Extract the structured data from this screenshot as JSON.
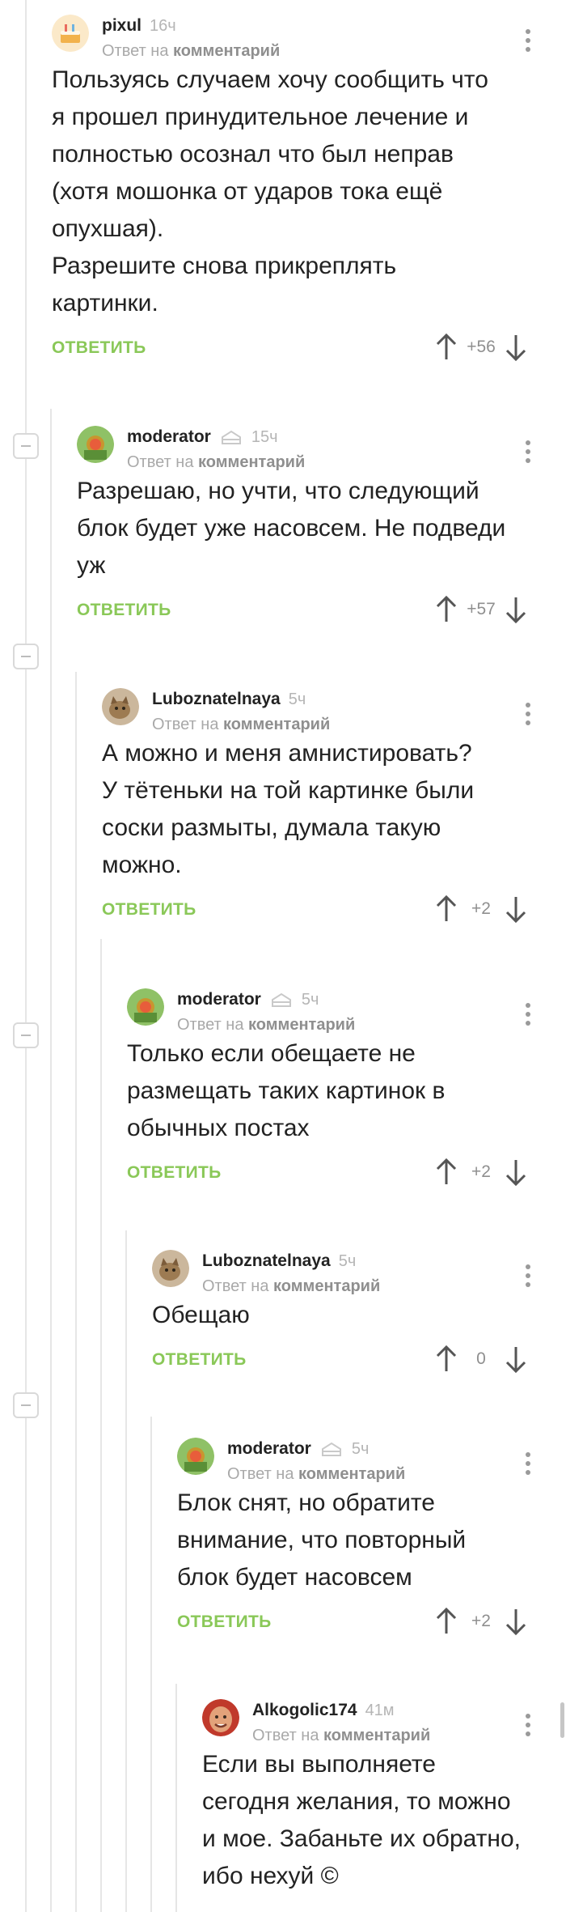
{
  "reply_label": "Ответ на",
  "reply_target": "комментарий",
  "action_reply": "ОТВЕТИТЬ",
  "colors": {
    "accent_green": "#8ac858",
    "thread_line": "#e6e6e6",
    "muted": "#a9a9a9"
  },
  "comments": [
    {
      "author": "pixul",
      "time": "16ч",
      "avatar": "cake-avatar",
      "text_lines": [
        "Пользуясь случаем хочу сообщить что",
        "я прошел принудительное лечение и",
        "полностью осознал что был неправ",
        "(хотя мошонка от ударов тока ещё",
        "опухшая).",
        "Разрешите снова прикреплять",
        "картинки."
      ],
      "rating": "+56"
    },
    {
      "author": "moderator",
      "time": "15ч",
      "avatar": "moderator-avatar",
      "text_lines": [
        "Разрешаю, но учти, что следующий",
        "блок будет уже насовсем. Не подведи",
        "уж"
      ],
      "rating": "+57"
    },
    {
      "author": "Luboznatelnaya",
      "time": "5ч",
      "avatar": "cat-avatar",
      "text_lines": [
        "А можно и меня амнистировать?",
        "У тётеньки на той картинке были",
        "соски размыты, думала такую",
        "можно."
      ],
      "rating": "+2"
    },
    {
      "author": "moderator",
      "time": "5ч",
      "avatar": "moderator-avatar",
      "text_lines": [
        "Только если обещаете не",
        "размещать таких картинок в",
        "обычных постах"
      ],
      "rating": "+2"
    },
    {
      "author": "Luboznatelnaya",
      "time": "5ч",
      "avatar": "cat-avatar",
      "text_lines": [
        "Обещаю"
      ],
      "rating": "0"
    },
    {
      "author": "moderator",
      "time": "5ч",
      "avatar": "moderator-avatar",
      "text_lines": [
        "Блок снят, но обратите",
        "внимание, что повторный",
        "блок будет насовсем"
      ],
      "rating": "+2"
    },
    {
      "author": "Alkogolic174",
      "time": "41м",
      "avatar": "face-avatar",
      "text_lines": [
        "Если вы выполняете",
        "сегодня желания, то можно",
        "и мое. Забаньте их обратно,",
        "ибо нехуй ©"
      ],
      "rating": ""
    }
  ]
}
